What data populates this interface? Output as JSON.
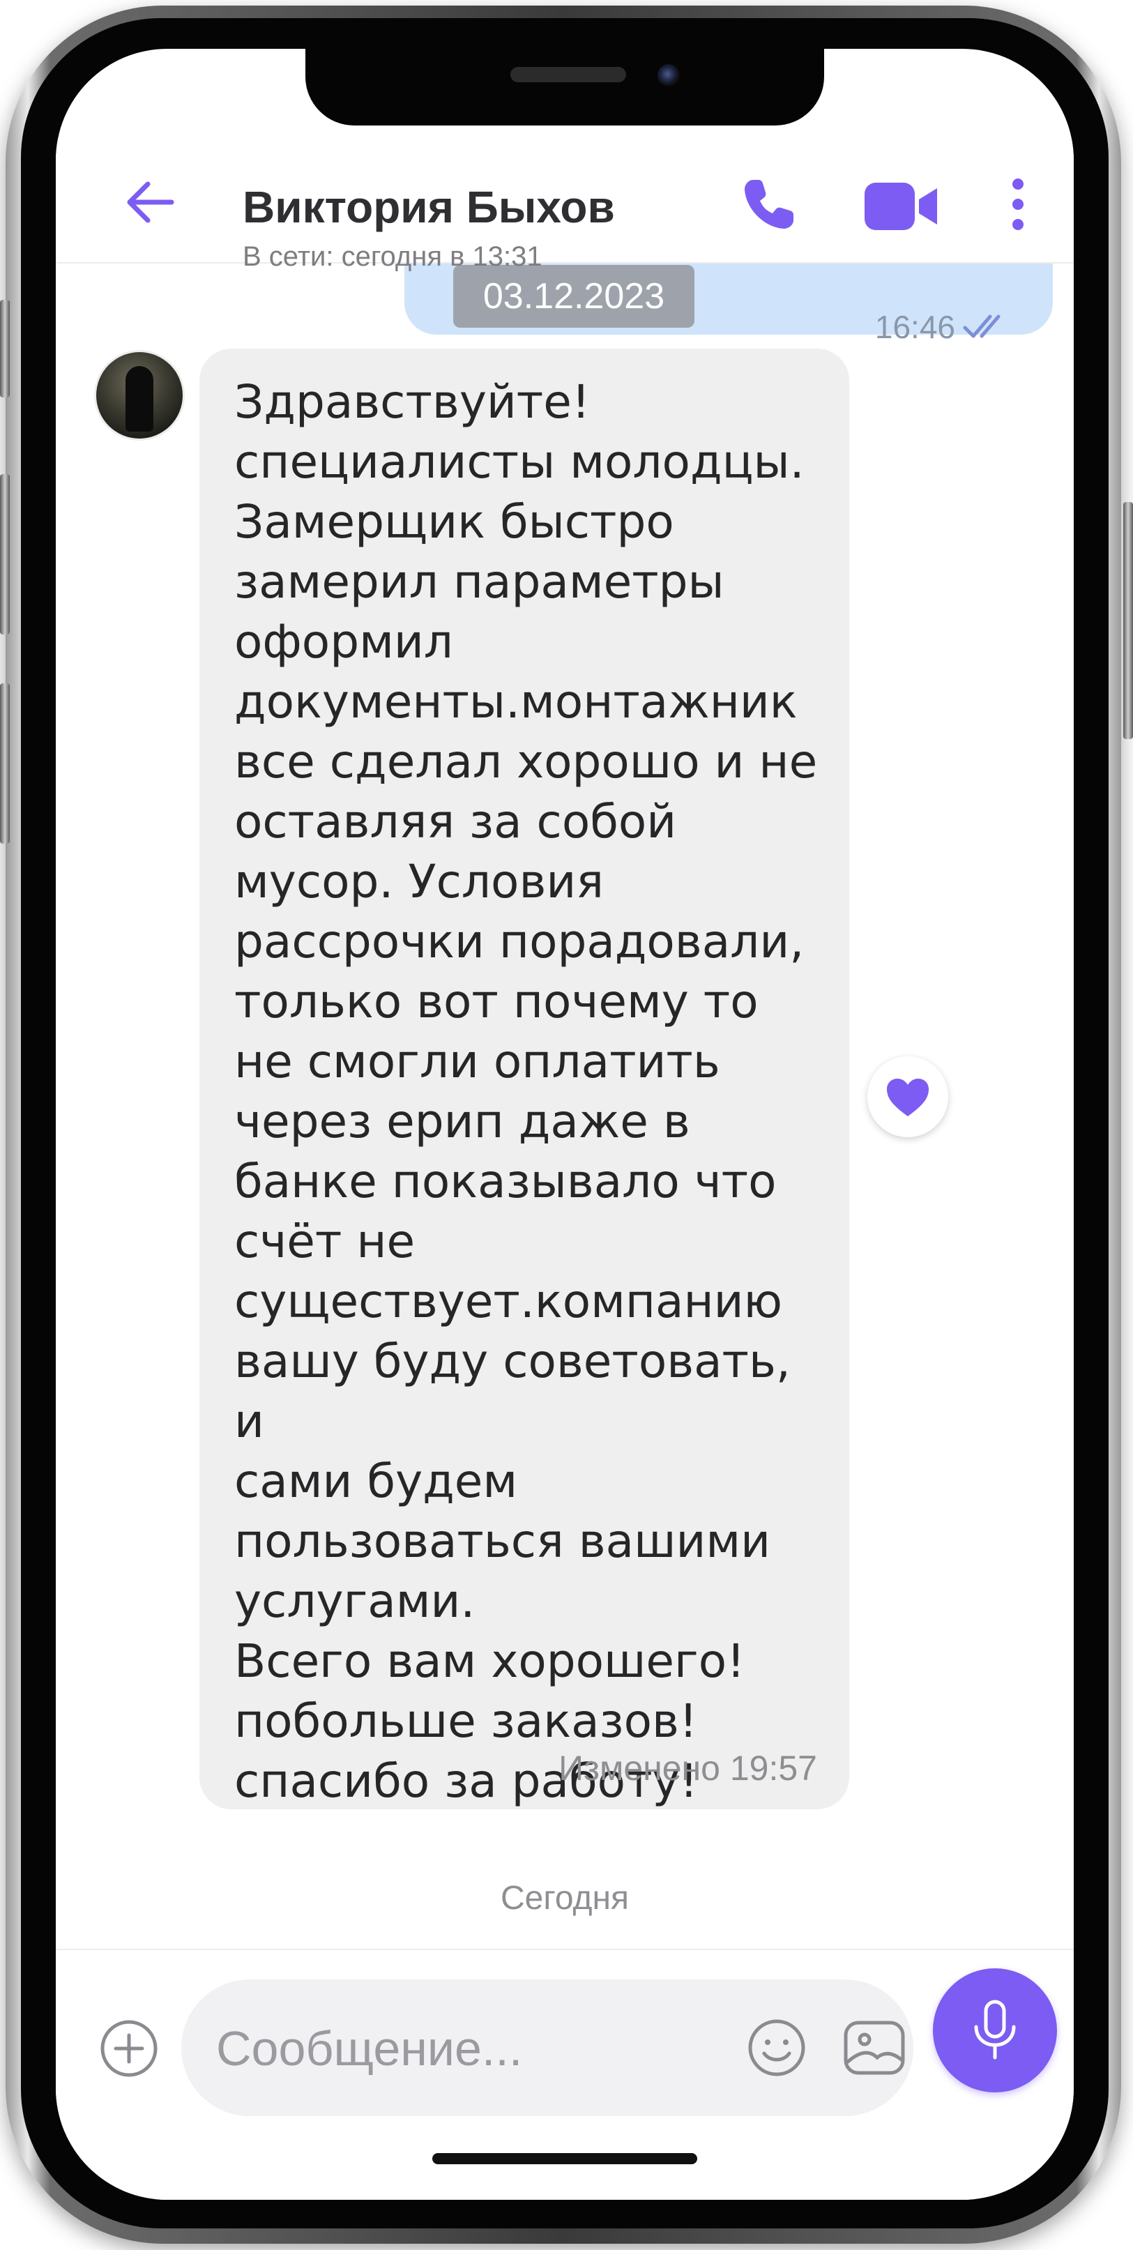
{
  "header": {
    "contact_name": "Виктория Быхов",
    "status": "В сети: сегодня в 13:31"
  },
  "previous_message": {
    "time": "16:46"
  },
  "date_pill": "03.12.2023",
  "message": {
    "text": "Здравствуйте!\nспециалисты молодцы.\nЗамерщик быстро\nзамерил параметры\nоформил\nдокументы.монтажник\nвсе сделал хорошо и не\nоставляя за собой\nмусор. Условия\nрассрочки порадовали,\nтолько вот почему то\nне смогли оплатить\nчерез ерип даже в\nбанке показывало что\nсчёт не\nсуществует.компанию\nвашу буду советовать, и\nсами будем\nпользоваться вашими\nуслугами.\nВсего вам хорошего!\nпобольше заказов!\nспасибо за работу!",
    "meta": "Изменено 19:57"
  },
  "day_label": "Сегодня",
  "composer": {
    "placeholder": "Сообщение..."
  },
  "colors": {
    "accent": "#7c5cf2",
    "incoming_bubble": "#efefef",
    "outgoing_bubble": "#cfe4fb"
  },
  "icons": [
    "back-arrow-icon",
    "phone-icon",
    "video-camera-icon",
    "more-vertical-icon",
    "heart-icon",
    "plus-circle-icon",
    "emoji-icon",
    "gallery-icon",
    "microphone-icon",
    "double-check-icon"
  ]
}
